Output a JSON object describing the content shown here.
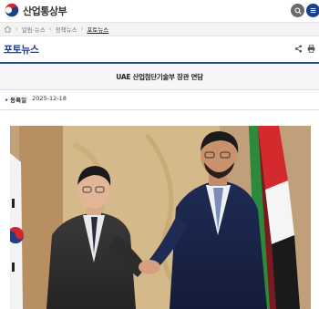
{
  "header": {
    "site_name": "산업통상부",
    "logo_icon": "taegeuk-logo-icon",
    "search_icon": "search-icon",
    "menu_icon": "menu-icon",
    "colors": {
      "brand_blue": "#1c3f8a",
      "search_bg": "#6a6a6a"
    }
  },
  "breadcrumb": {
    "home_icon": "home-icon",
    "items": [
      "알림·뉴스",
      "정책뉴스",
      "포토뉴스"
    ]
  },
  "page": {
    "title": "포토뉴스",
    "share_icon": "share-icon",
    "print_icon": "print-icon"
  },
  "article": {
    "title": "UAE 산업첨단기술부 장관 면담",
    "date_label": "등록일",
    "date_value": "2025-12-18"
  },
  "photo": {
    "description_icon": "photo-image"
  }
}
